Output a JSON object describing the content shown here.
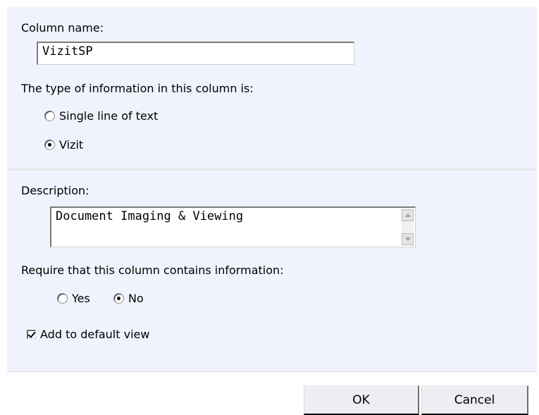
{
  "column_name": {
    "label": "Column name:",
    "value": "VizitSP"
  },
  "info_type": {
    "label": "The type of information in this column is:",
    "options": [
      {
        "label": "Single line of text",
        "checked": false
      },
      {
        "label": "Vizit",
        "checked": true
      }
    ]
  },
  "description": {
    "label": "Description:",
    "value": "Document Imaging & Viewing"
  },
  "required": {
    "label": "Require that this column contains information:",
    "options": [
      {
        "label": "Yes",
        "checked": false
      },
      {
        "label": "No",
        "checked": true
      }
    ]
  },
  "default_view": {
    "label": "Add to default view",
    "checked": true
  },
  "buttons": {
    "ok": "OK",
    "cancel": "Cancel"
  },
  "colors": {
    "panel_background": "#f0f3fd",
    "button_background": "#eceef2"
  }
}
